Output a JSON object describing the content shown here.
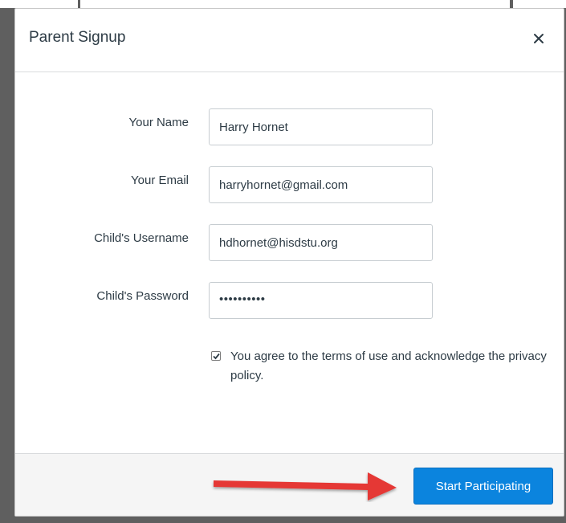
{
  "modal": {
    "title": "Parent Signup",
    "close_icon": "close-icon"
  },
  "form": {
    "fields": [
      {
        "label": "Your Name",
        "value": "Harry Hornet"
      },
      {
        "label": "Your Email",
        "value": "harryhornet@gmail.com"
      },
      {
        "label": "Child's Username",
        "value": "hdhornet@hisdstu.org"
      },
      {
        "label": "Child's Password",
        "value": "••••••••••"
      }
    ],
    "agreement": {
      "checked": true,
      "text_before": "You agree to the ",
      "terms_link": "terms of use",
      "text_middle": " and acknowledge the ",
      "privacy_link": "privacy policy",
      "text_after": "."
    }
  },
  "footer": {
    "submit_label": "Start Participating"
  },
  "colors": {
    "primary_button": "#0b84de",
    "annotation_arrow": "#e53935"
  }
}
